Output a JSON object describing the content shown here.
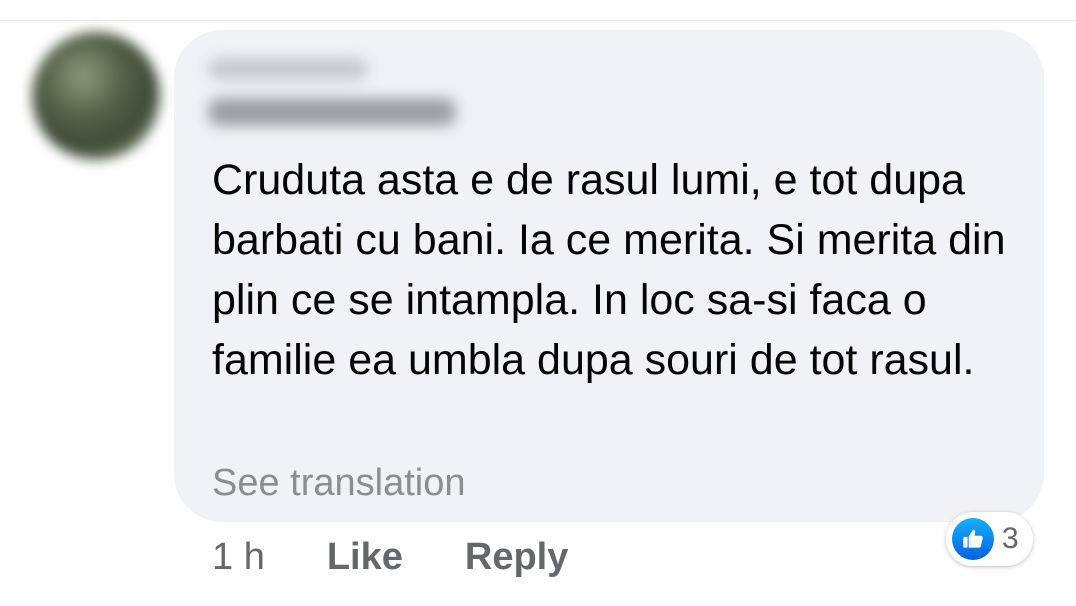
{
  "comment": {
    "text": "Cruduta asta e de rasul lumi, e tot dupa barbati cu bani. Ia ce merita. Si merita din plin ce se intampla. In loc sa-si faca o familie ea umbla dupa souri de tot rasul.",
    "see_translation": "See translation"
  },
  "actions": {
    "timestamp": "1 h",
    "like_label": "Like",
    "reply_label": "Reply"
  },
  "reactions": {
    "icon": "thumbs-up-icon",
    "count": "3",
    "color": "#1877f2"
  },
  "colors": {
    "bubble": "#f0f2f5",
    "text": "#050505",
    "muted": "#65676b",
    "translation": "#8a8d91"
  }
}
